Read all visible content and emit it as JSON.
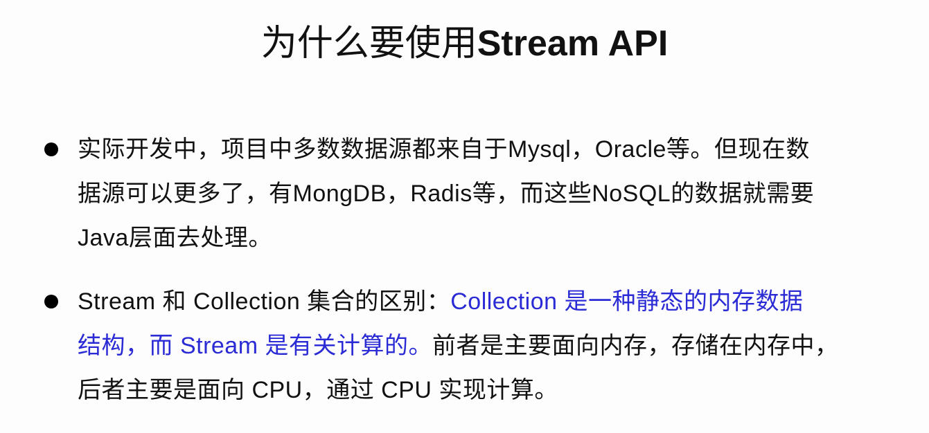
{
  "slide": {
    "title_cn": "为什么要使用",
    "title_en": "Stream API",
    "bullets": [
      {
        "lines": [
          "实际开发中，项目中多数数据源都来自于Mysql，Oracle等。但现在数",
          "据源可以更多了，有MongDB，Radis等，而这些NoSQL的数据就需要",
          "Java层面去处理。"
        ]
      },
      {
        "line1_black": "Stream 和 Collection 集合的区别：",
        "line1_blue": "Collection 是一种静态的内存数据",
        "line2_blue": "结构，而 Stream 是有关计算的。",
        "line2_black": "前者是主要面向内存，存储在内存中，",
        "line3_black": "后者主要是面向 CPU，通过 CPU 实现计算。"
      }
    ]
  },
  "colors": {
    "text": "#111111",
    "highlight": "#2b2bd6",
    "background": "#fdfdfd"
  }
}
